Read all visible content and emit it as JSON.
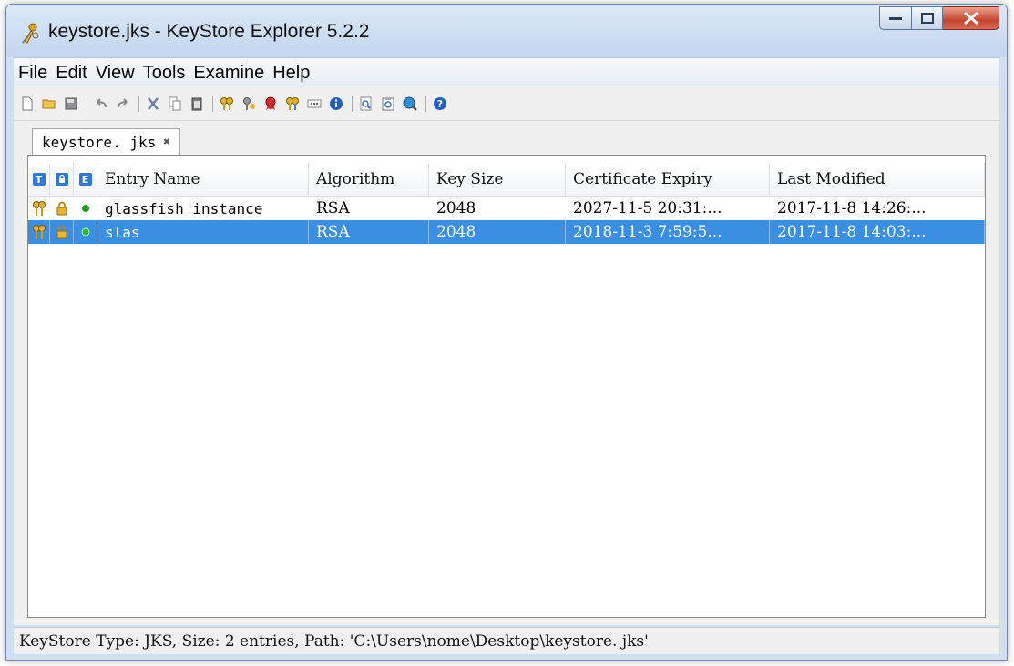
{
  "window": {
    "title": "keystore.jks - KeyStore Explorer 5.2.2"
  },
  "menu": [
    "File",
    "Edit",
    "View",
    "Tools",
    "Examine",
    "Help"
  ],
  "toolbar_groups": [
    [
      "new-icon",
      "open-icon",
      "save-icon"
    ],
    [
      "undo-icon",
      "redo-icon"
    ],
    [
      "cut-icon",
      "copy-icon",
      "paste-icon"
    ],
    [
      "generate-key-pair-icon",
      "generate-secret-key-icon",
      "import-trusted-certificate-icon",
      "import-key-pair-icon",
      "set-password-icon",
      "properties-icon"
    ],
    [
      "examine-file-icon",
      "examine-clipboard-icon",
      "examine-ssl-icon"
    ],
    [
      "help-icon"
    ]
  ],
  "tab": {
    "label": "keystore. jks",
    "close": "✖"
  },
  "table": {
    "headers": {
      "type": "T",
      "lock": "",
      "expiry_status": "E",
      "name": "Entry Name",
      "algorithm": "Algorithm",
      "key_size": "Key Size",
      "cert_expiry": "Certificate Expiry",
      "last_modified": "Last Modified"
    },
    "rows": [
      {
        "name": "glassfish_instance",
        "algorithm": "RSA",
        "key_size": "2048",
        "cert_expiry": "2027-11-5 20:31:...",
        "last_modified": "2017-11-8 14:26:...",
        "selected": false,
        "entry_type": "key-pair-icon",
        "status_color": "#1aa31a"
      },
      {
        "name": "slas",
        "algorithm": "RSA",
        "key_size": "2048",
        "cert_expiry": "2018-11-3 7:59:5...",
        "last_modified": "2017-11-8 14:03:...",
        "selected": true,
        "entry_type": "key-pair-icon",
        "status_color": "#26c026"
      }
    ]
  },
  "status": {
    "text": "KeyStore Type: JKS, Size: 2 entries, Path: 'C:\\Users\\nome\\Desktop\\keystore. jks'"
  },
  "colors": {
    "selection": "#3b8fe3",
    "header_icon": "#2f7ad8"
  }
}
